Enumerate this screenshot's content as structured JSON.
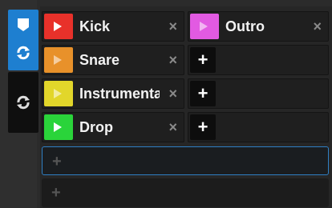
{
  "sidebar": {
    "tabs": [
      {
        "name": "clips",
        "icons": [
          "clip-icon",
          "refresh-icon"
        ],
        "active": true
      },
      {
        "name": "recorded",
        "icons": [
          "refresh-icon"
        ],
        "active": false
      }
    ]
  },
  "slots_left": [
    {
      "label": "Kick",
      "color": "#e8312a",
      "close": "×"
    },
    {
      "label": "Snare",
      "color": "#e8912a",
      "close": "×"
    },
    {
      "label": "Instrumental",
      "color": "#e2d62a",
      "close": "×"
    },
    {
      "label": "Drop",
      "color": "#2ad43a",
      "close": "×"
    }
  ],
  "slots_right": [
    {
      "label": "Outro",
      "color": "#e25ae2",
      "close": "×",
      "empty": false
    },
    {
      "add": "+",
      "empty": true
    },
    {
      "add": "+",
      "empty": true
    },
    {
      "add": "+",
      "empty": true
    }
  ],
  "new_rows": [
    {
      "plus": "+",
      "focused": true
    },
    {
      "plus": "+",
      "focused": false
    }
  ]
}
